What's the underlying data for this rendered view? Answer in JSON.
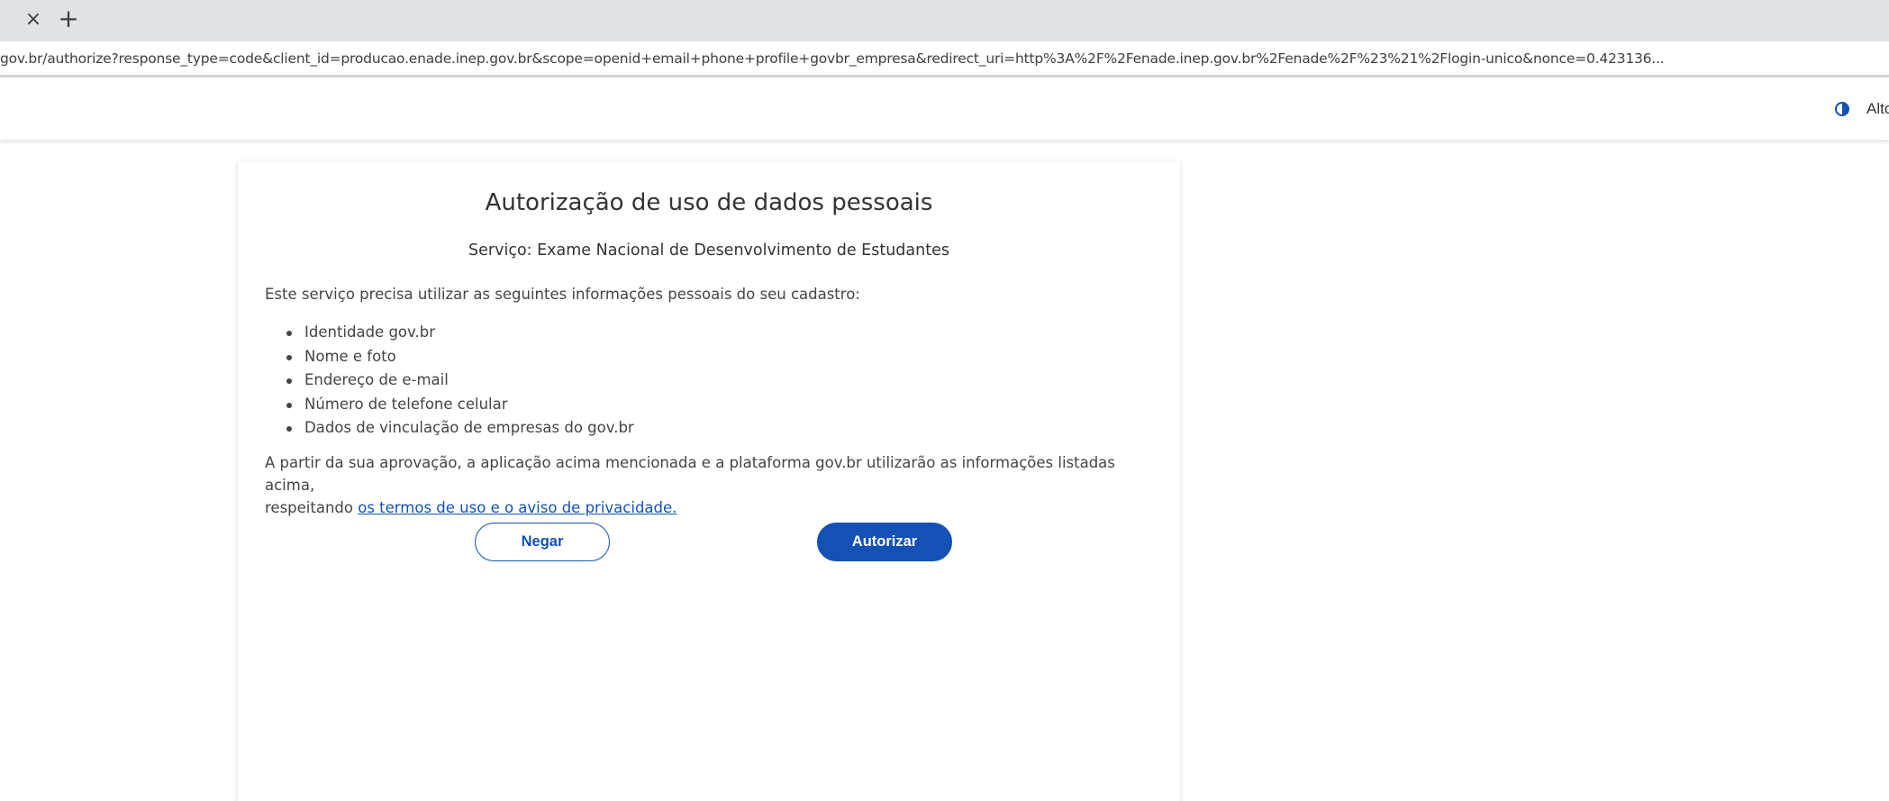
{
  "browser": {
    "tab_close_glyph": "×",
    "new_tab_glyph": "+",
    "url": "gov.br/authorize?response_type=code&client_id=producao.enade.inep.gov.br&scope=openid+email+phone+profile+govbr_empresa&redirect_uri=http%3A%2F%2Fenade.inep.gov.br%2Fenade%2F%23%21%2Flogin-unico&nonce=0.423136..."
  },
  "header": {
    "contrast_label": "Alto Co"
  },
  "consent": {
    "title": "Autorização de uso de dados pessoais",
    "service_label": "Serviço:",
    "service_name": "Exame Nacional de Desenvolvimento de Estudantes",
    "intro": "Este serviço precisa utilizar as seguintes informações pessoais do seu cadastro:",
    "items": [
      "Identidade gov.br",
      "Nome e foto",
      "Endereço de e-mail",
      "Número de telefone celular",
      "Dados de vinculação de empresas do gov.br"
    ],
    "disclaimer_line1": "A partir da sua aprovação, a aplicação acima mencionada e a plataforma gov.br utilizarão as informações listadas acima,",
    "disclaimer_line2_prefix": "respeitando",
    "terms_link": "os termos de uso e o aviso de privacidade.",
    "deny_label": "Negar",
    "authorize_label": "Autorizar"
  },
  "colors": {
    "primary": "#1351b4",
    "tab_strip": "#dfe3e8"
  }
}
